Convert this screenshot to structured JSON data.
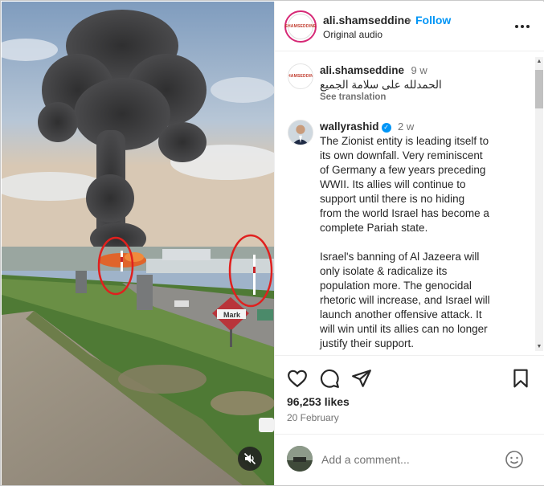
{
  "post": {
    "username": "ali.shamseddine",
    "separator": "•",
    "follow_label": "Follow",
    "audio": "Original audio",
    "avatar_logo": "SHAMSEDDINE"
  },
  "media": {
    "sign_text": "Mark",
    "mute_icon": "muted-speaker-icon"
  },
  "comments": [
    {
      "username": "ali.shamseddine",
      "time": "9 w",
      "text": "الحمدلله على سلامة الجميع",
      "translation_label": "See translation",
      "verified": false
    },
    {
      "username": "wallyrashid",
      "time": "2 w",
      "verified": true,
      "paragraph1_lines": [
        "The Zionist entity is leading itself to",
        "its own downfall. Very reminiscent",
        "of Germany a few years preceding",
        "WWII. Its allies will continue to",
        "support until there is no hiding",
        "from the world Israel has become a",
        "complete Pariah state."
      ],
      "paragraph2_lines": [
        "Israel's banning of Al Jazeera will",
        "only isolate & radicalize its",
        "population more. The genocidal",
        "rhetoric will increase, and Israel will",
        "launch another offensive attack. It",
        "will win until its allies can no longer",
        "justify their support."
      ]
    }
  ],
  "actions": {
    "likes": "96,253 likes",
    "date": "20 February",
    "add_comment_placeholder": "Add a comment...",
    "icons": [
      "heart-icon",
      "comment-icon",
      "share-icon",
      "bookmark-icon",
      "emoji-icon"
    ]
  },
  "colors": {
    "accent": "#0095f6",
    "text": "#262626",
    "secondary": "#737373",
    "annotation_red": "#e0201e"
  }
}
